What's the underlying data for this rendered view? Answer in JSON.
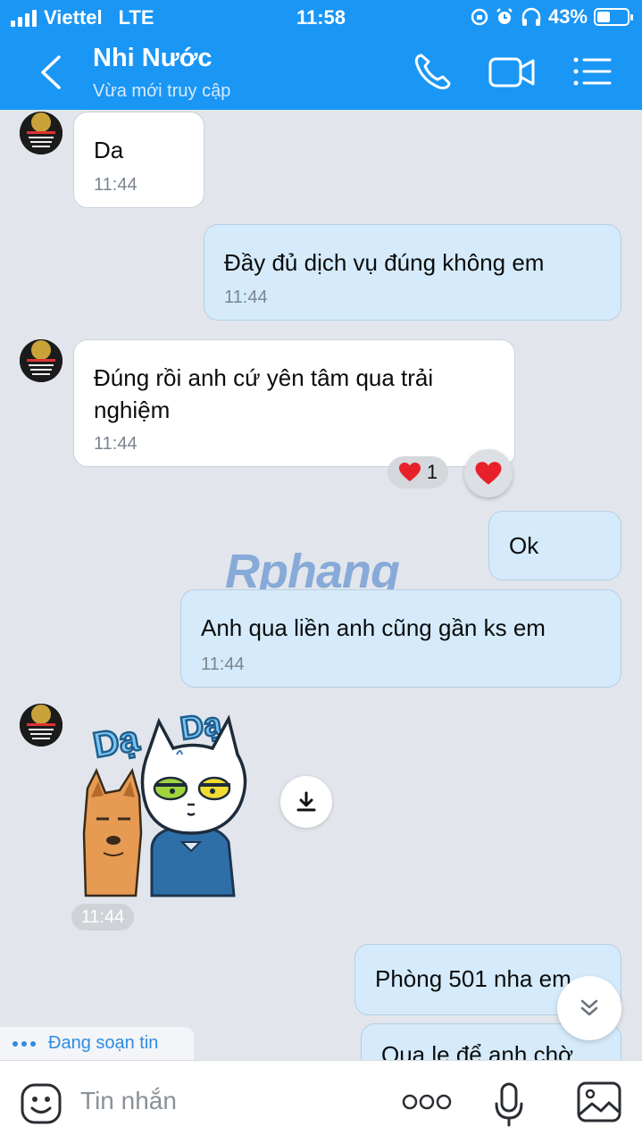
{
  "status_bar": {
    "carrier": "Viettel",
    "network": "LTE",
    "time": "11:58",
    "battery_percent": "43%",
    "battery_level": 0.43
  },
  "header": {
    "contact_name": "Nhi Nước",
    "contact_status": "Vừa mới truy cập",
    "background_color": "#1a96f5"
  },
  "messages": [
    {
      "direction": "incoming",
      "text": "Da",
      "time": "11:44"
    },
    {
      "direction": "outgoing",
      "text": "Đầy đủ dịch vụ đúng không em",
      "time": "11:44"
    },
    {
      "direction": "incoming",
      "text": "Đúng rồi anh cứ yên tâm qua trải nghiệm",
      "time": "11:44",
      "reaction": {
        "icon": "heart-icon",
        "count": "1"
      }
    },
    {
      "direction": "outgoing",
      "text": "Ok"
    },
    {
      "direction": "outgoing",
      "text": "Anh qua liền anh cũng gần ks em",
      "time": "11:44"
    },
    {
      "direction": "incoming",
      "type": "sticker",
      "sticker_text": [
        "Dạ",
        "Dạ"
      ],
      "time": "11:44"
    },
    {
      "direction": "outgoing",
      "text": "Phòng 501 nha em"
    },
    {
      "direction": "outgoing",
      "text": "Qua le để anh chờ"
    }
  ],
  "watermark": "Rphang",
  "typing_indicator": "Đang soạn tin",
  "input": {
    "placeholder": "Tin nhắn"
  },
  "icons": {
    "back": "chevron-left-icon",
    "call": "phone-icon",
    "video": "video-camera-icon",
    "menu": "list-menu-icon",
    "emoji": "emoji-icon",
    "more": "more-dots-icon",
    "mic": "microphone-icon",
    "image": "image-icon",
    "download": "download-icon",
    "scroll_down": "double-chevron-down-icon"
  }
}
